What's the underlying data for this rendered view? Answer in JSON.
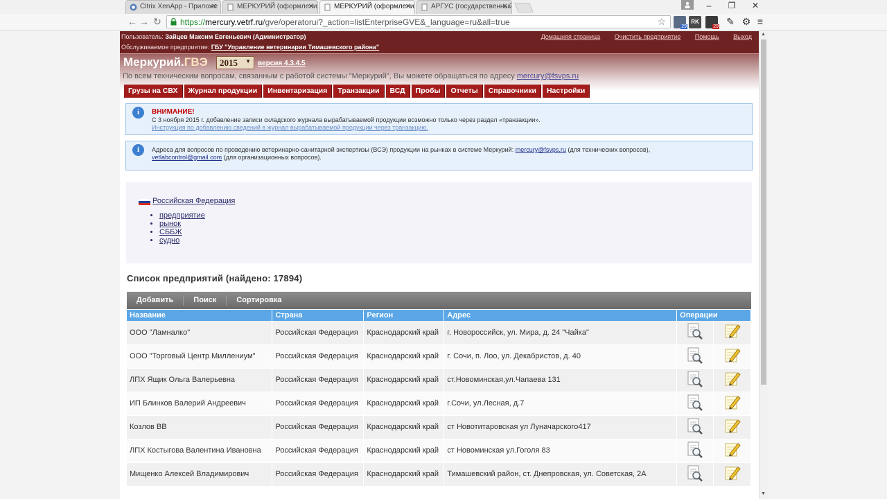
{
  "browser": {
    "tabs": [
      {
        "title": "Citrix XenApp - Приложе",
        "active": false
      },
      {
        "title": "МЕРКУРИЙ (оформлени",
        "active": false
      },
      {
        "title": "МЕРКУРИЙ (оформлени",
        "active": true
      },
      {
        "title": "АРГУС (государственный",
        "active": false
      }
    ],
    "url_scheme": "https://",
    "url_host": "mercury.vetrf.ru",
    "url_path": "/gve/operatorui?_action=listEnterpriseGVE&_language=ru&all=true",
    "extension_badges": [
      "29",
      "29"
    ],
    "window_controls": [
      "–",
      "❐",
      "✕"
    ]
  },
  "header": {
    "user_label": "Пользователь:",
    "user_name": "Зайцев Максим Евгеньевич (Администратор)",
    "enterprise_label": "Обслуживаемое предприятие:",
    "enterprise_name": "ГБУ \"Управление ветеринарии Тимашевского района\"",
    "links": [
      "Домашняя страница",
      "Очистить предприятие",
      "Помощь",
      "Выход"
    ],
    "brand_main": "Меркурий.",
    "brand_sub": "ГВЭ",
    "year": "2015",
    "version": "версия 4.3.4.5",
    "support_text": "По всем техническим вопросам, связанным с работой системы \"Меркурий\", Вы можете обращаться по адресу ",
    "support_email": "mercury@fsvps.ru"
  },
  "menu": [
    "Грузы на СВХ",
    "Журнал продукции",
    "Инвентаризация",
    "Транзакции",
    "ВСД",
    "Пробы",
    "Отчеты",
    "Справочники",
    "Настройки"
  ],
  "notice1": {
    "title": "ВНИМАНИЕ!",
    "text": "С 3 ноября 2015 г. добавление записи складского журнала вырабатываемой продукции возможно только через раздел «транзакции».",
    "link": "Инструкция по добавлению сведений в журнал вырабатываемой продукции через транзакцию."
  },
  "notice2": {
    "text_a": "Адреса для вопросов по проведению ветеринарно-санитарной экспертизы (ВСЭ) продукции на рынках в системе Меркурий: ",
    "email_a": "mercury@fsvps.ru",
    "text_b": " (для технических вопросов),",
    "email_b": "vetlabcontrol@gmail.com",
    "text_c": " (для организационных вопросов)."
  },
  "country": {
    "name": "Российская Федерация",
    "types": [
      "предприятие",
      "рынок",
      "СББЖ",
      "судно"
    ],
    "flag_colors": [
      "#ffffff",
      "#1c3f9c",
      "#d52b1e"
    ]
  },
  "list": {
    "title": "Список предприятий (найдено: 17894)",
    "actions": [
      "Добавить",
      "Поиск",
      "Сортировка"
    ],
    "columns": [
      "Название",
      "Страна",
      "Регион",
      "Адрес",
      "Операции"
    ],
    "rows": [
      {
        "name": "ООО \"Ламналко\"",
        "country": "Российская Федерация",
        "region": "Краснодарский край",
        "address": "г. Новороссийск, ул. Мира, д. 24 \"Чайка\""
      },
      {
        "name": "ООО \"Торговый Центр Миллениум\"",
        "country": "Российская Федерация",
        "region": "Краснодарский край",
        "address": "г. Сочи, п. Лоо, ул. Декабристов, д. 40"
      },
      {
        "name": "ЛПХ Ящик Ольга Валерьевна",
        "country": "Российская Федерация",
        "region": "Краснодарский край",
        "address": "ст.Новоминская,ул.Чапаева 131"
      },
      {
        "name": "ИП Блинков Валерий Андреевич",
        "country": "Российская Федерация",
        "region": "Краснодарский край",
        "address": "г.Сочи, ул.Лесная, д.7"
      },
      {
        "name": "Козлов ВВ",
        "country": "Российская Федерация",
        "region": "Краснодарский край",
        "address": "ст Новотитаровская ул Луначарского417"
      },
      {
        "name": "ЛПХ Костыгова Валентина Ивановна",
        "country": "Российская Федерация",
        "region": "Краснодарский край",
        "address": "ст Новоминская ул.Гоголя 83"
      },
      {
        "name": "Мищенко Алексей Владимирович",
        "country": "Российская Федерация",
        "region": "Краснодарский край",
        "address": "Тимашевский район, ст. Днепровская, ул. Советская, 2А"
      }
    ]
  },
  "icons": {
    "view": "magnifier-page-icon",
    "edit": "pencil-note-icon"
  },
  "colors": {
    "header_bg": "#6e2222",
    "menu_bg": "#a31c1c",
    "table_header": "#5aa6e6",
    "notice_bg": "#e7f1fb"
  }
}
